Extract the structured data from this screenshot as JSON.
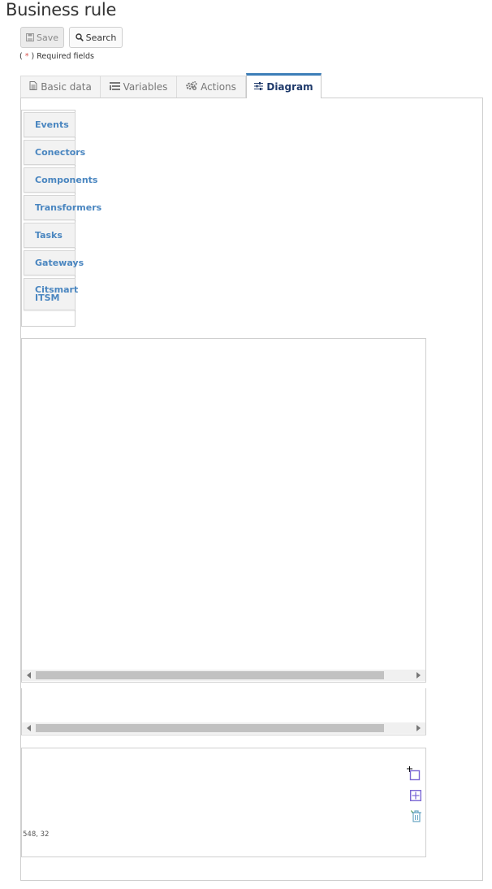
{
  "page": {
    "title": "Business rule"
  },
  "toolbar": {
    "save_label": "Save",
    "search_label": "Search"
  },
  "form": {
    "required_open": "( ",
    "required_star": "*",
    "required_close": " ) Required fields"
  },
  "tabs": [
    {
      "label": "Basic data",
      "icon": "file-text-icon",
      "active": false
    },
    {
      "label": "Variables",
      "icon": "list-icon",
      "active": false
    },
    {
      "label": "Actions",
      "icon": "cogs-icon",
      "active": false
    },
    {
      "label": "Diagram",
      "icon": "sliders-icon",
      "active": true
    }
  ],
  "palette": {
    "items": [
      {
        "label": "Events"
      },
      {
        "label": "Conectors"
      },
      {
        "label": "Components"
      },
      {
        "label": "Transformers"
      },
      {
        "label": "Tasks"
      },
      {
        "label": "Gateways"
      },
      {
        "label_line1": "Citsmart",
        "label_line2": "ITSM"
      }
    ]
  },
  "outline": {
    "coordinates": "548, 32",
    "tools": [
      "select-icon",
      "zoom-fit-icon",
      "delete-icon"
    ]
  },
  "colors": {
    "accent": "#3d7eb8",
    "palette_text": "#4a86c0",
    "required_star": "#d9534f",
    "tool_icon": "#7b68d4"
  }
}
